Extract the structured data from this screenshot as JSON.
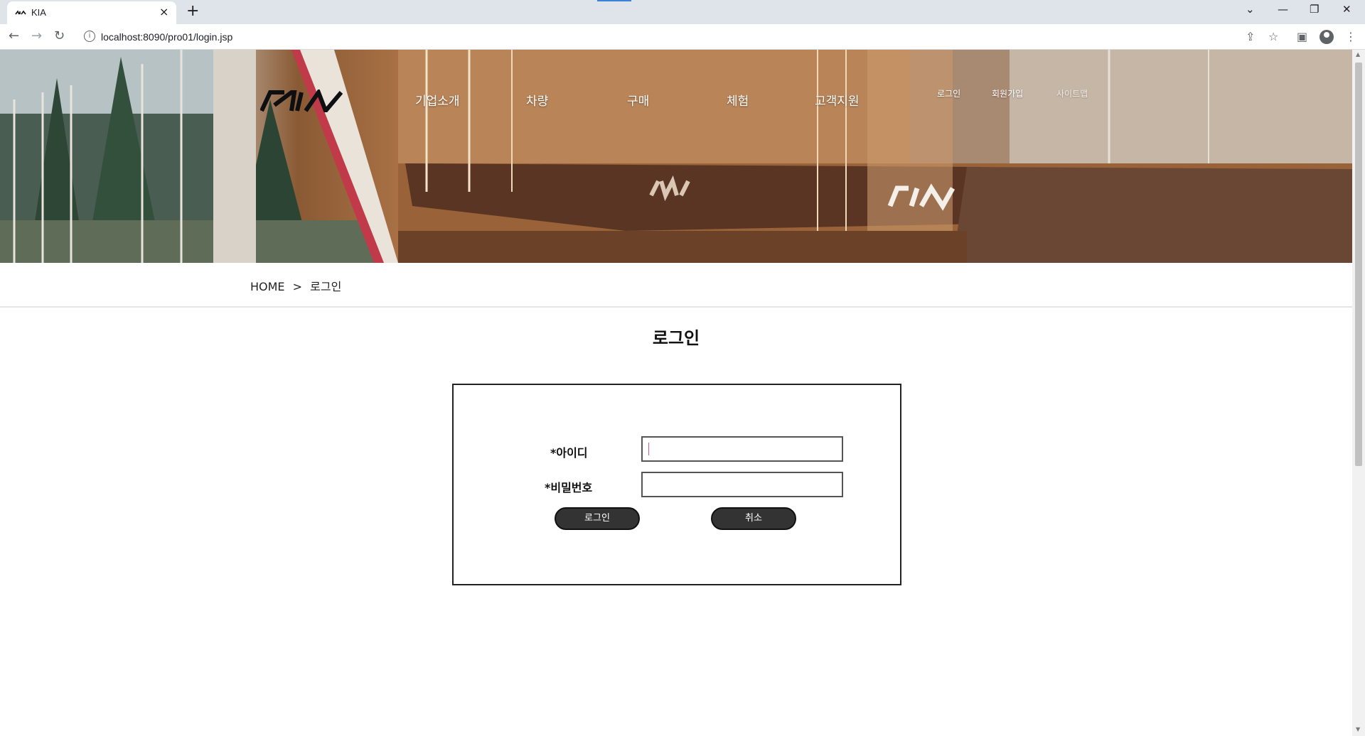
{
  "browser": {
    "tab_title": "KIA",
    "tab_close": "×",
    "new_tab": "+",
    "url": "localhost:8090/pro01/login.jsp",
    "win_controls": [
      "⌄",
      "—",
      "❐",
      "✕"
    ]
  },
  "header": {
    "gnb": [
      "기업소개",
      "차량",
      "구매",
      "체험",
      "고객지원"
    ],
    "util": [
      "로그인",
      "회원가입",
      "사이트맵"
    ]
  },
  "breadcrumb": {
    "home": "HOME",
    "sep": ">",
    "current": "로그인"
  },
  "page_title": "로그인",
  "login_form": {
    "id_label": "*아이디",
    "id_value": "",
    "pw_label": "*비밀번호",
    "pw_value": "",
    "submit_label": "로그인",
    "cancel_label": "취소"
  },
  "colors": {
    "button_bg": "#333333",
    "box_border": "#222222"
  }
}
